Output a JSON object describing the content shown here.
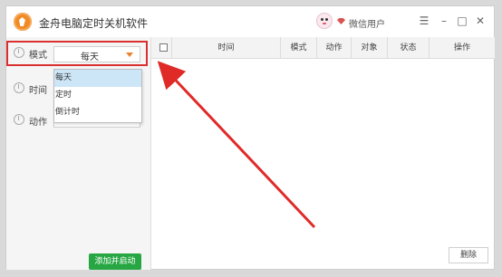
{
  "window": {
    "title": "金舟电脑定时关机软件",
    "user_name": "微信用户"
  },
  "form": {
    "mode_label": "模式",
    "mode_value": "每天",
    "time_label": "时间",
    "action_label": "动作",
    "mode_options": [
      {
        "label": "每天",
        "selected": true
      },
      {
        "label": "定时",
        "selected": false
      },
      {
        "label": "倒计时",
        "selected": false
      }
    ],
    "add_button": "添加并启动"
  },
  "table": {
    "columns": [
      "时间",
      "模式",
      "动作",
      "对象",
      "状态",
      "操作"
    ]
  },
  "delete_button": "删除",
  "colors": {
    "accent_green": "#27a744",
    "highlight_red": "#d9302f",
    "chevron_orange": "#e8832e",
    "selected_option": "#cde6f7"
  }
}
